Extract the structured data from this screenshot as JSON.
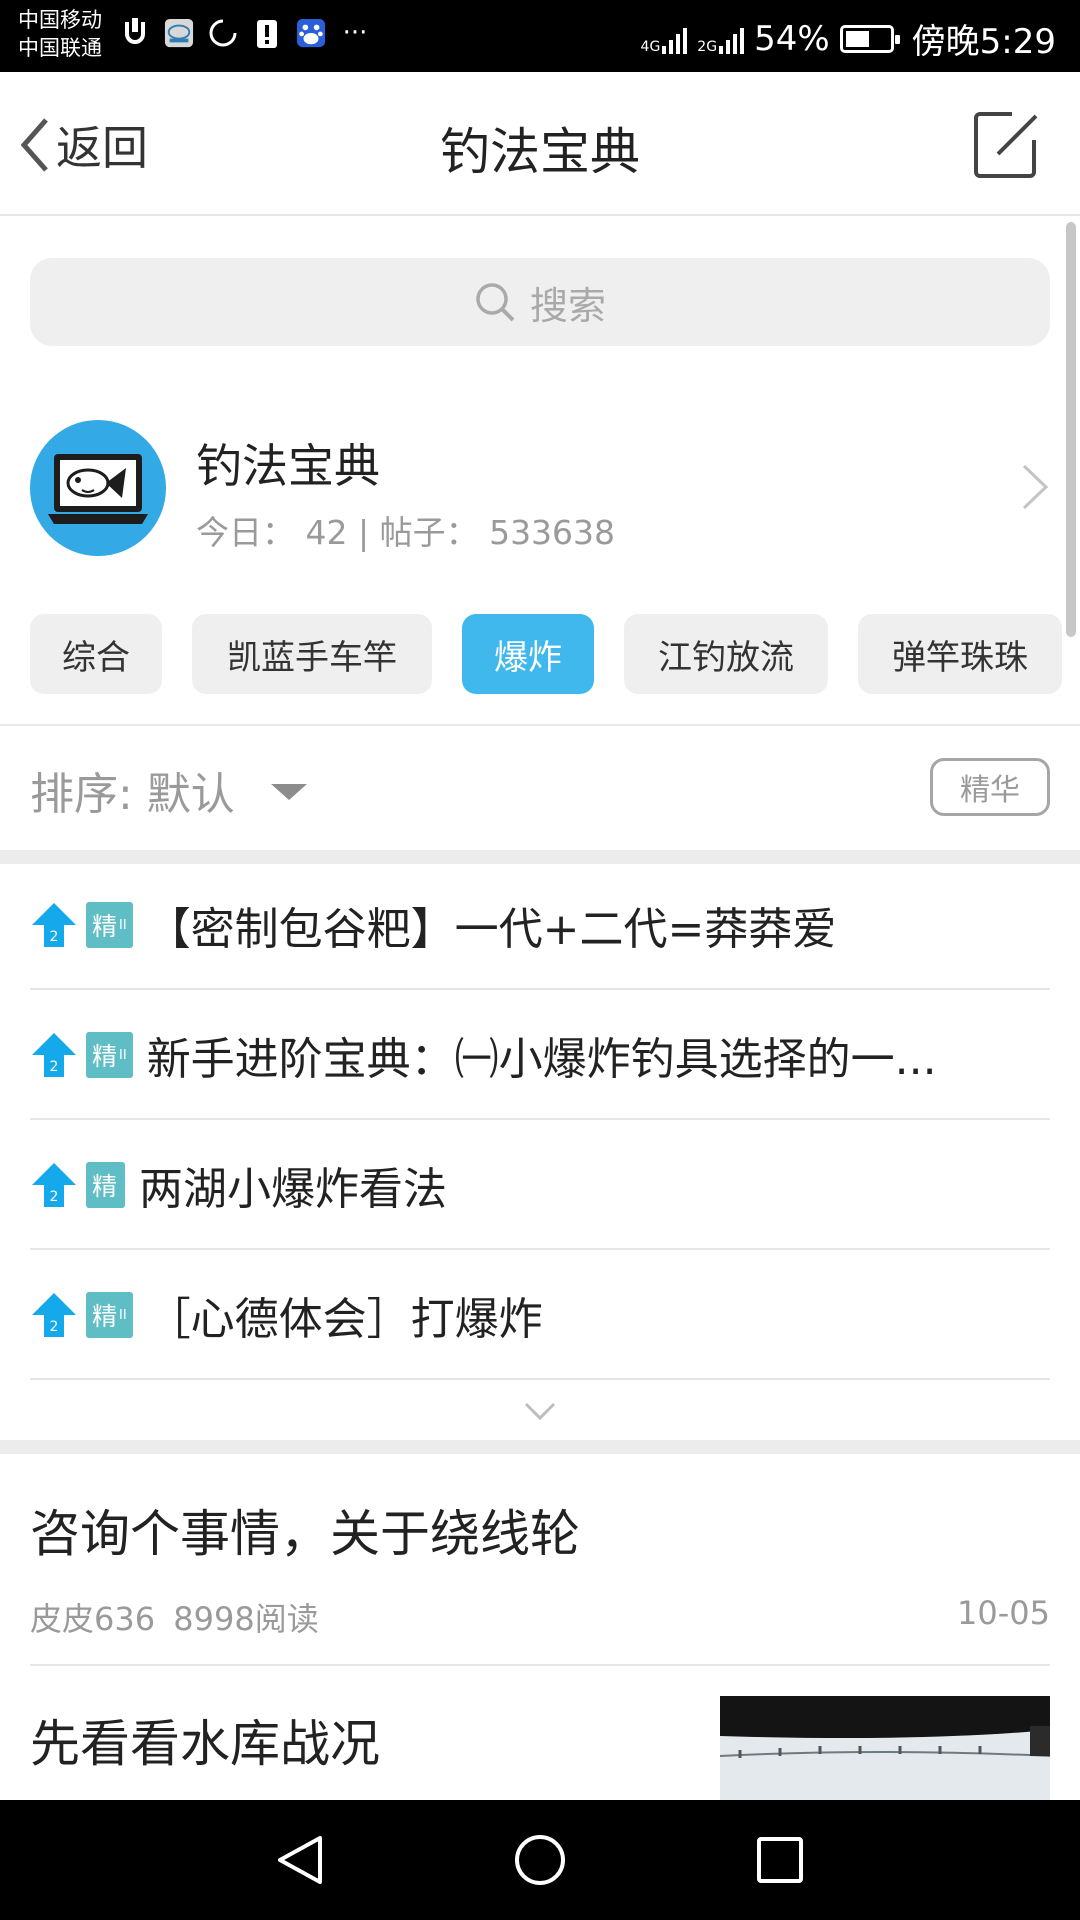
{
  "status_bar": {
    "carrier_1": "中国移动",
    "carrier_2": "中国联通",
    "net_1": "4G",
    "net_2": "2G",
    "battery": "54%",
    "battery_level": 0.54,
    "time": "傍晚5:29",
    "more": "···"
  },
  "header": {
    "back_label": "返回",
    "title": "钓法宝典"
  },
  "search": {
    "placeholder": "搜索"
  },
  "forum": {
    "name": "钓法宝典",
    "stats": "今日： 42 | 帖子： 533638"
  },
  "tabs": [
    {
      "label": "综合"
    },
    {
      "label": "凯蓝手车竿"
    },
    {
      "label": "爆炸",
      "active": true
    },
    {
      "label": "江钓放流"
    },
    {
      "label": "弹竿珠珠"
    }
  ],
  "sort": {
    "label": "排序: 默认",
    "featured_filter": "精华"
  },
  "pinned": [
    {
      "badge": "精",
      "badge_level": "II",
      "title": "【密制包谷粑】一代+二代=莽莽爱"
    },
    {
      "badge": "精",
      "badge_level": "II",
      "title": "新手进阶宝典：㈠小爆炸钓具选择的一..."
    },
    {
      "badge": "精",
      "badge_level": "",
      "title": "两湖小爆炸看法"
    },
    {
      "badge": "精",
      "badge_level": "II",
      "title": "［心德体会］打爆炸"
    }
  ],
  "posts": [
    {
      "title": "咨询个事情，关于绕线轮",
      "author": "皮皮636",
      "reads": "8998阅读",
      "date": "10-05"
    },
    {
      "title": "先看看水库战况"
    }
  ],
  "colors": {
    "accent": "#40b8ee",
    "badge": "#5fbec5",
    "pin_icon": "#14a9ea"
  }
}
